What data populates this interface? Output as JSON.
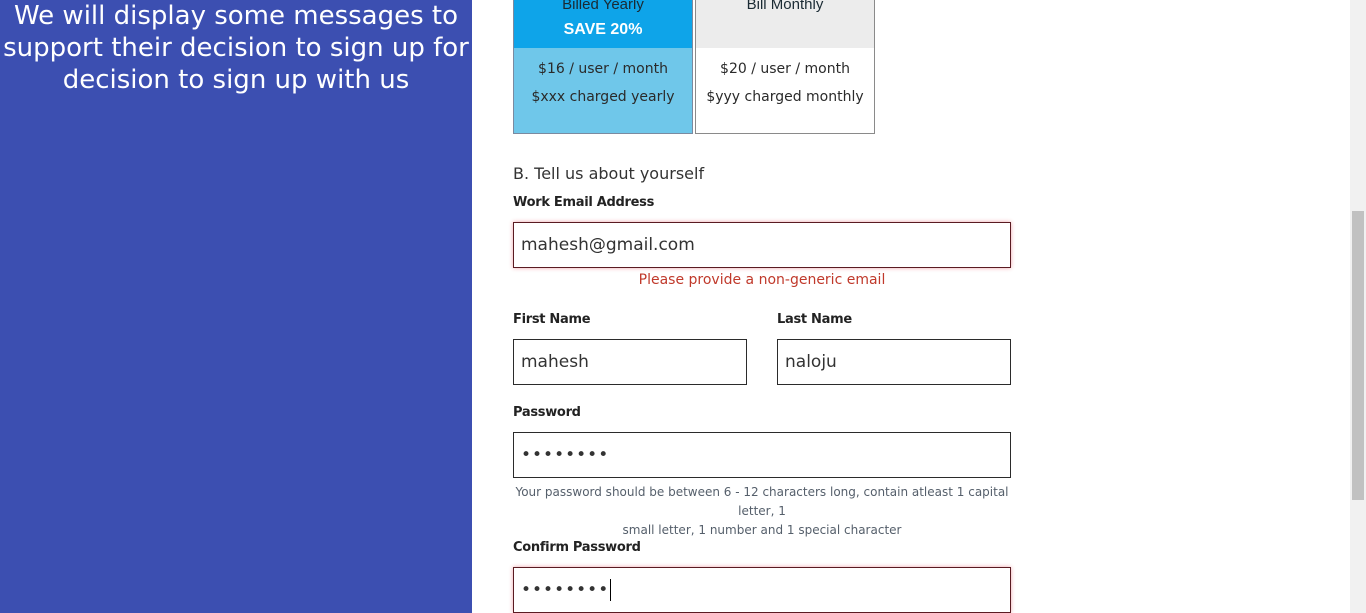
{
  "left": {
    "message_lines": [
      "We will display some messages to",
      "support their decision to sign up for",
      "decision to sign up with us"
    ]
  },
  "plans": {
    "yearly": {
      "name": "Billed Yearly",
      "save": "SAVE 20%",
      "price": "$16 / user / month",
      "charge": "$xxx charged yearly"
    },
    "monthly": {
      "name": "Bill Monthly",
      "price": "$20 / user / month",
      "charge": "$yyy charged monthly"
    }
  },
  "form": {
    "section_title": "B. Tell us about yourself",
    "email": {
      "label": "Work Email Address",
      "value": "mahesh@gmail.com",
      "error": "Please provide a non-generic email"
    },
    "first_name": {
      "label": "First Name",
      "value": "mahesh"
    },
    "last_name": {
      "label": "Last Name",
      "value": "naloju"
    },
    "password": {
      "label": "Password",
      "value": "••••••••",
      "hint_lines": [
        "Your password should be between 6 - 12 characters long, contain atleast 1 capital letter, 1",
        "small letter, 1 number and 1 special character"
      ]
    },
    "confirm_password": {
      "label": "Confirm Password",
      "value": "••••••••"
    }
  },
  "colors": {
    "left_panel": "#3c4fb1",
    "yearly_header": "#0ea4e9",
    "yearly_body": "#6fc7ea",
    "error": "#c0392b"
  }
}
